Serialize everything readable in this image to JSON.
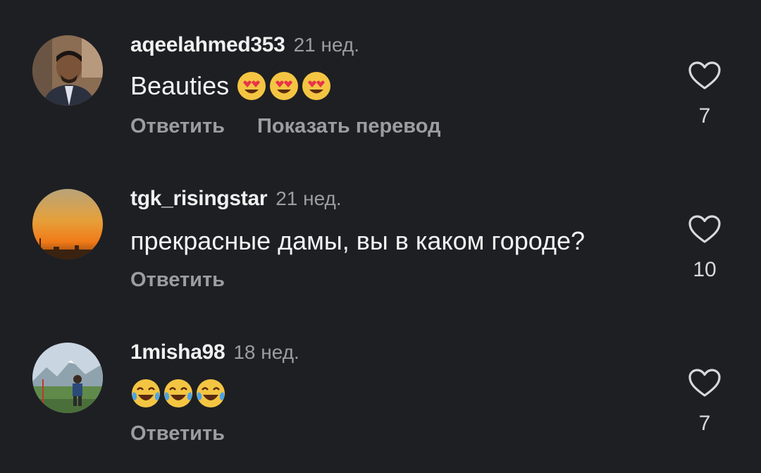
{
  "comments": [
    {
      "username": "aqeelahmed353",
      "time": "21 нед.",
      "text": "Beauties",
      "emoji": [
        "heart-eyes-emoji",
        "heart-eyes-emoji",
        "heart-eyes-emoji"
      ],
      "reply_label": "Ответить",
      "translate_label": "Показать перевод",
      "likes": "7"
    },
    {
      "username": "tgk_risingstar",
      "time": "21 нед.",
      "text": "прекрасные дамы, вы в каком городе?",
      "reply_label": "Ответить",
      "likes": "10"
    },
    {
      "username": "1misha98",
      "time": "18 нед.",
      "text": "",
      "emoji": [
        "tears-of-joy-emoji",
        "tears-of-joy-emoji",
        "tears-of-joy-emoji"
      ],
      "reply_label": "Ответить",
      "likes": "7"
    }
  ],
  "colors": {
    "background": "#1e1f23",
    "secondary_text": "#9c9ca2",
    "primary_text": "#f2f2f2"
  }
}
